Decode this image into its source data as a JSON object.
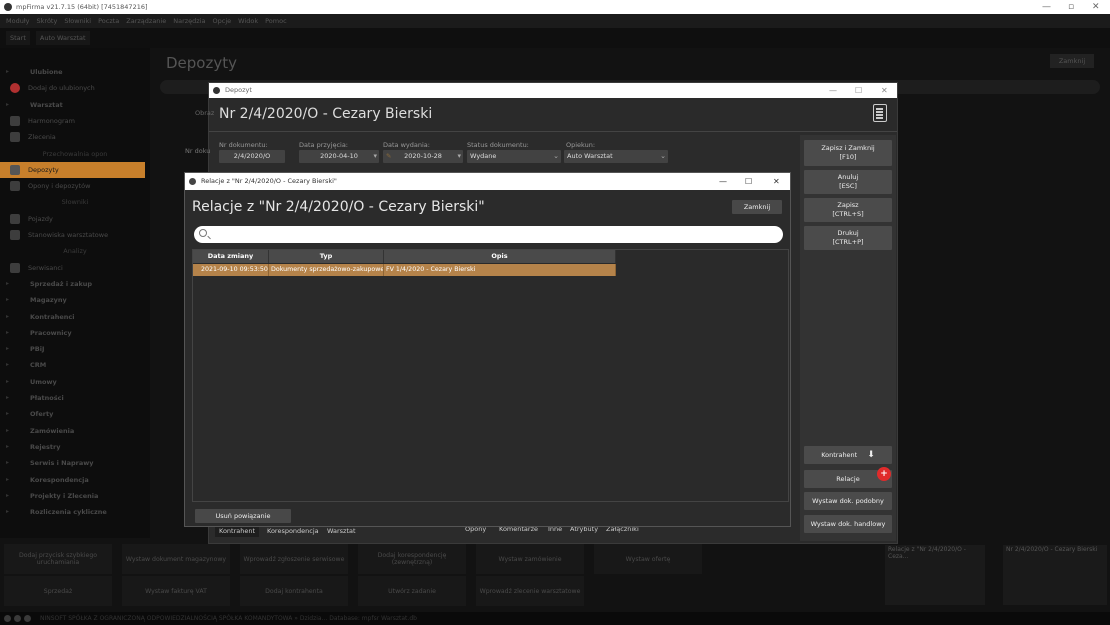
{
  "app": {
    "title": "mpFirma v21.7.15 (64bit) [7451847216]",
    "menu": [
      "Moduły",
      "Skróty",
      "Słowniki",
      "Poczta",
      "Zarządzanie",
      "Narzędzia",
      "Opcje",
      "Widok",
      "Pomoc"
    ],
    "tabs": [
      "Start",
      "Auto Warsztat"
    ]
  },
  "sidebar": {
    "items": [
      {
        "label": "Ulubione",
        "type": "head"
      },
      {
        "label": "Dodaj do ulubionych",
        "type": "item"
      },
      {
        "label": "Warsztat",
        "type": "head"
      },
      {
        "label": "Harmonogram",
        "type": "item"
      },
      {
        "label": "Zlecenia",
        "type": "item"
      },
      {
        "label": "Przechowalnia opon",
        "type": "sub"
      },
      {
        "label": "Depozyty",
        "type": "item"
      },
      {
        "label": "Opony i depozytów",
        "type": "item"
      },
      {
        "label": "Słowniki",
        "type": "sub"
      },
      {
        "label": "Pojazdy",
        "type": "item"
      },
      {
        "label": "Stanowiska warsztatowe",
        "type": "item"
      },
      {
        "label": "Analizy",
        "type": "sub"
      },
      {
        "label": "Serwisanci",
        "type": "item"
      },
      {
        "label": "Sprzedaż i zakup",
        "type": "head"
      },
      {
        "label": "Magazyny",
        "type": "head"
      },
      {
        "label": "Kontrahenci",
        "type": "head"
      },
      {
        "label": "Pracownicy",
        "type": "head"
      },
      {
        "label": "PBiJ",
        "type": "head"
      },
      {
        "label": "CRM",
        "type": "head"
      },
      {
        "label": "Umowy",
        "type": "head"
      },
      {
        "label": "Płatności",
        "type": "head"
      },
      {
        "label": "Oferty",
        "type": "head"
      },
      {
        "label": "Zamówienia",
        "type": "head"
      },
      {
        "label": "Rejestry",
        "type": "head"
      },
      {
        "label": "Serwis i Naprawy",
        "type": "head"
      },
      {
        "label": "Korespondencja",
        "type": "head"
      },
      {
        "label": "Projekty i Zlecenia",
        "type": "head"
      },
      {
        "label": "Rozliczenia cykliczne",
        "type": "head"
      }
    ]
  },
  "background": {
    "title": "Depozyty",
    "close_label": "Zamknij"
  },
  "bottom_tiles": [
    "Dodaj przycisk szybkiego uruchamiania",
    "Wystaw dokument magazynowy",
    "Wprowadź zgłoszenie serwisowe",
    "Dodaj korespondencję (zewnętrzną)",
    "Wystaw zamówienie",
    "Wystaw ofertę",
    "Sprzedaż",
    "Wystaw fakturę VAT",
    "Dodaj kontrahenta",
    "Utwórz zadanie",
    "Wprowadź zlecenie warsztatowe"
  ],
  "thumbnails": [
    "Relacje z \"Nr 2/4/2020/O - Ceza...",
    "Nr 2/4/2020/O - Cezary Bierski"
  ],
  "status_text": "NINSOFT SPÓŁKA Z OGRANICZONĄ ODPOWIEDZIALNOŚCIĄ SPÓŁKA KOMANDYTOWA » Dzidzia... Database: mpfsr Warsztat.db",
  "depozyt": {
    "window_title": "Depozyt",
    "heading": "Nr 2/4/2020/O - Cezary Bierski",
    "fields": {
      "nr_label": "Nr dokumentu:",
      "nr_value": "2/4/2020/O",
      "przyjecie_label": "Data przyjęcia:",
      "przyjecie_value": "2020-04-10",
      "wydanie_label": "Data wydania:",
      "wydanie_value": "2020-10-28",
      "status_label": "Status dokumentu:",
      "status_value": "Wydane",
      "opiekun_label": "Opiekun:",
      "opiekun_value": "Auto Warsztat"
    },
    "buttons": {
      "save_close": "Zapisz i Zamknij",
      "save_close_key": "[F10]",
      "cancel": "Anuluj",
      "cancel_key": "[ESC]",
      "save": "Zapisz",
      "save_key": "[CTRL+S]",
      "print": "Drukuj",
      "print_key": "[CTRL+P]",
      "kontrahent": "Kontrahent",
      "relacje": "Relacje",
      "podobny": "Wystaw dok. podobny",
      "handlowy": "Wystaw dok. handlowy"
    },
    "tabs_left": [
      "Kontrahent",
      "Korespondencja",
      "Warsztat"
    ],
    "tabs_right": [
      "Opony",
      "Komentarze",
      "Inne",
      "Atrybuty",
      "Załączniki"
    ],
    "bg_labels": {
      "obraz": "Obraz",
      "nr_doku": "Nr doku"
    }
  },
  "relacje": {
    "window_title": "Relacje z \"Nr 2/4/2020/O - Cezary Bierski\"",
    "heading": "Relacje z \"Nr 2/4/2020/O - Cezary Bierski\"",
    "close_label": "Zamknij",
    "search_value": "",
    "columns": [
      "Data zmiany",
      "Typ",
      "Opis"
    ],
    "rows": [
      [
        "2021-09-10 09:53:50",
        "Dokumenty sprzedażowo-zakupowe",
        "FV 1/4/2020 - Cezary Bierski"
      ]
    ],
    "unlink_label": "Usuń powiązanie"
  },
  "colors": {
    "accent": "#b5834a",
    "badge": "#e02b2b",
    "dialog_bg": "#2b2b2b"
  }
}
